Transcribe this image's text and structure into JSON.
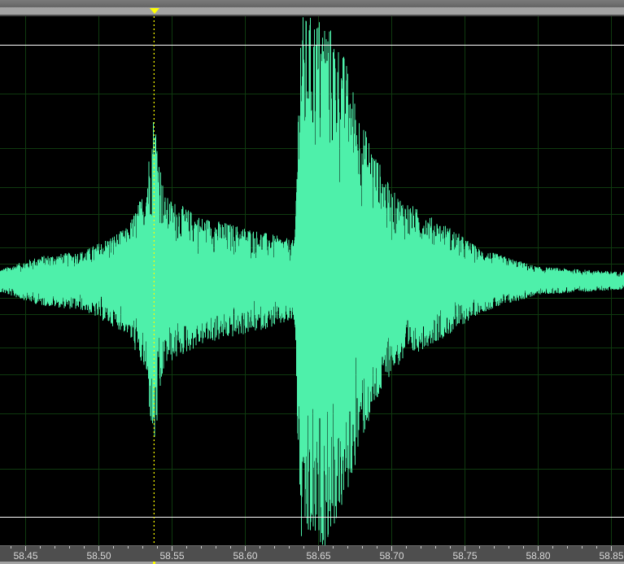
{
  "editor": {
    "view": "waveform",
    "time_unit": "seconds",
    "visible_range": [
      58.4328,
      58.8589
    ],
    "playhead_time": 58.538,
    "colors": {
      "waveform": "#4ef0aa",
      "grid": "#0f3a0f",
      "clip_line": "#ffffff",
      "playhead": "#ffff00",
      "center_line": "#b02020"
    }
  },
  "ruler": {
    "labels": [
      "58.45",
      "58.50",
      "58.55",
      "58.60",
      "58.65",
      "58.70",
      "58.75",
      "58.80",
      "58.85"
    ],
    "major_times": [
      58.45,
      58.5,
      58.55,
      58.6,
      58.65,
      58.7,
      58.75,
      58.8,
      58.85
    ],
    "minor_step": 0.01
  },
  "waveform_envelope": {
    "times": [
      58.433,
      58.46,
      58.49,
      58.52,
      58.532,
      58.538,
      58.545,
      58.57,
      58.6,
      58.634,
      58.638,
      58.655,
      58.668,
      58.68,
      58.7,
      58.72,
      58.74,
      58.76,
      58.8,
      58.859
    ],
    "amplitudes": [
      0.04,
      0.09,
      0.11,
      0.2,
      0.35,
      0.65,
      0.32,
      0.24,
      0.2,
      0.15,
      1.0,
      1.0,
      0.85,
      0.6,
      0.34,
      0.26,
      0.2,
      0.12,
      0.05,
      0.03
    ]
  }
}
